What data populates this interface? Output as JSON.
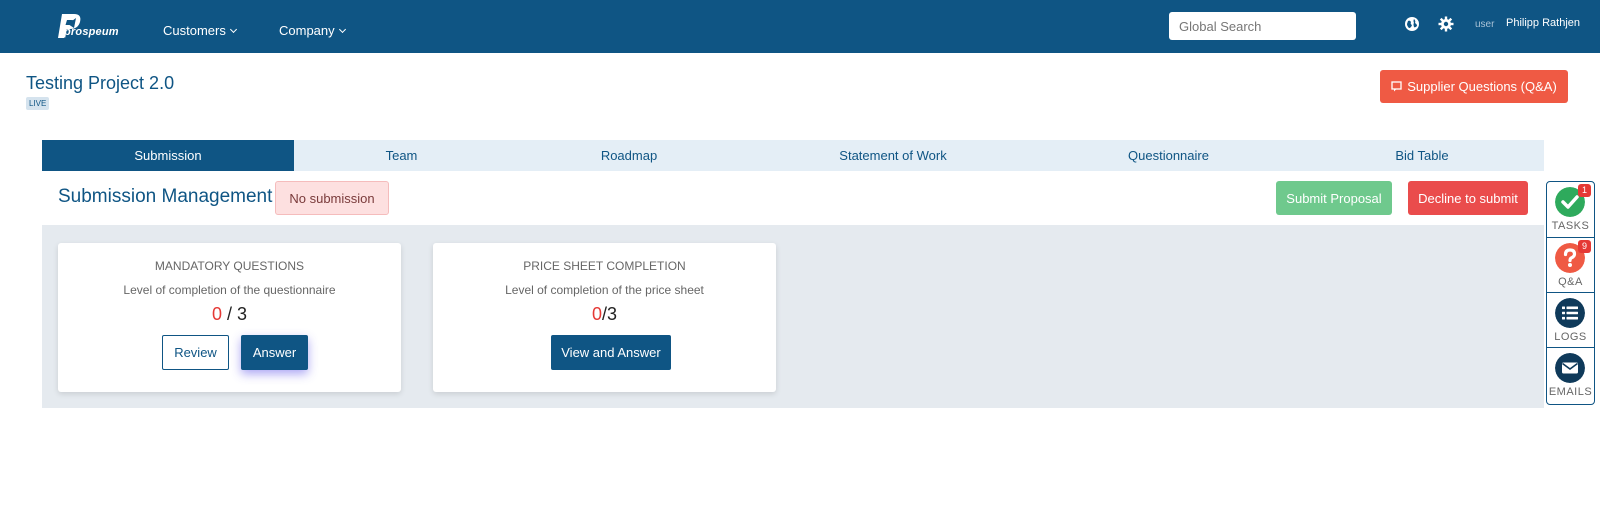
{
  "nav": {
    "logo_text": "prospeum",
    "menu": [
      {
        "label": "Customers"
      },
      {
        "label": "Company"
      }
    ],
    "search_placeholder": "Global Search",
    "user_role": "user",
    "user_name": "Philipp Rathjen"
  },
  "project": {
    "title": "Testing Project 2.0",
    "status": "LIVE",
    "supplier_questions_label": "Supplier Questions (Q&A)"
  },
  "tabs": [
    {
      "label": "Submission",
      "active": true
    },
    {
      "label": "Team"
    },
    {
      "label": "Roadmap"
    },
    {
      "label": "Statement of Work"
    },
    {
      "label": "Questionnaire"
    },
    {
      "label": "Bid Table"
    }
  ],
  "submission": {
    "title": "Submission Management",
    "status": "No submission",
    "submit_label": "Submit Proposal",
    "decline_label": "Decline to submit"
  },
  "cards": [
    {
      "title": "Mandatory Questions",
      "subtitle": "Level of completion of the questionnaire",
      "done": "0",
      "separator": " / ",
      "total": "3",
      "buttons": [
        "Review",
        "Answer"
      ]
    },
    {
      "title": "Price Sheet Completion",
      "subtitle": "Level of completion of the price sheet",
      "done": "0",
      "separator": "/",
      "total": "3",
      "buttons": [
        "View and Answer"
      ]
    }
  ],
  "rail": [
    {
      "label": "TASKS",
      "badge": "1",
      "icon": "check-circle-icon",
      "color": "#2eaa5c"
    },
    {
      "label": "Q&A",
      "badge": "9",
      "icon": "question-circle-icon",
      "color": "#ef5a44"
    },
    {
      "label": "LOGS",
      "icon": "list-circle-icon",
      "color": "#0f3a5a"
    },
    {
      "label": "EMAILS",
      "icon": "envelope-circle-icon",
      "color": "#0f3a5a"
    }
  ],
  "colors": {
    "brand": "#0f5584",
    "danger": "#ea4c4c",
    "success": "#6fc98d",
    "accent": "#ef5a44"
  }
}
